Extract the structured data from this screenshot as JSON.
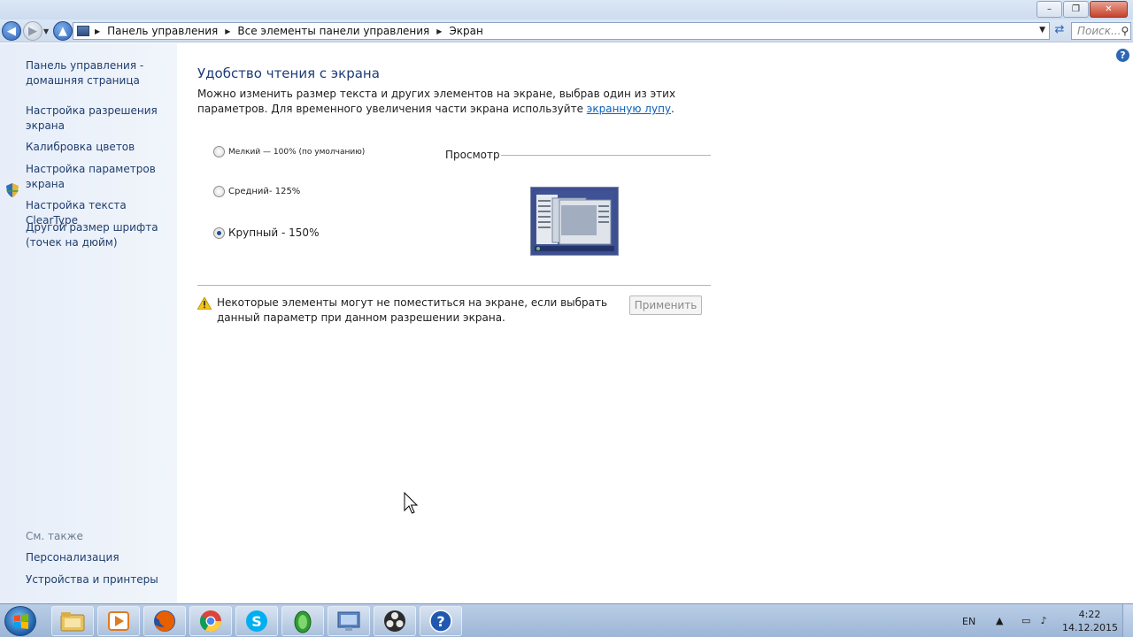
{
  "window": {
    "minimize_label": "–",
    "maximize_label": "❐",
    "close_label": "✕"
  },
  "address": {
    "crumbs": [
      "Панель управления",
      "Все элементы панели управления",
      "Экран"
    ],
    "search_placeholder": "Поиск..."
  },
  "sidebar": {
    "home_link": "Панель управления - домашняя страница",
    "links": [
      "Настройка разрешения экрана",
      "Калибровка цветов",
      "Настройка параметров экрана",
      "Настройка текста ClearType",
      "Другой размер шрифта (точек на дюйм)"
    ],
    "see_also_title": "См. также",
    "see_also_links": [
      "Персонализация",
      "Устройства и принтеры"
    ]
  },
  "main": {
    "title": "Удобство чтения с экрана",
    "desc_before": "Можно изменить размер текста и других элементов на экране, выбрав один из этих параметров. Для временного увеличения части экрана используйте ",
    "desc_link": "экранную лупу",
    "desc_after": ".",
    "options": [
      {
        "label": "Мелкий — 100% (по умолчанию)",
        "selected": false
      },
      {
        "label": "Средний- 125%",
        "selected": false
      },
      {
        "label": "Крупный - 150%",
        "selected": true
      }
    ],
    "preview_label": "Просмотр",
    "warning": "Некоторые элементы могут не поместиться на экране, если выбрать данный параметр при данном разрешении экрана.",
    "apply_label": "Применить"
  },
  "taskbar": {
    "icons": [
      "explorer-icon",
      "media-player-icon",
      "firefox-icon",
      "chrome-icon",
      "skype-icon",
      "green-app-icon",
      "control-panel-icon",
      "obs-icon",
      "help-icon"
    ],
    "lang": "EN",
    "time": "4:22",
    "date": "14.12.2015"
  },
  "colors": {
    "link": "#1f3d6e",
    "title": "#1e3c78",
    "accent": "#2d64b8"
  }
}
